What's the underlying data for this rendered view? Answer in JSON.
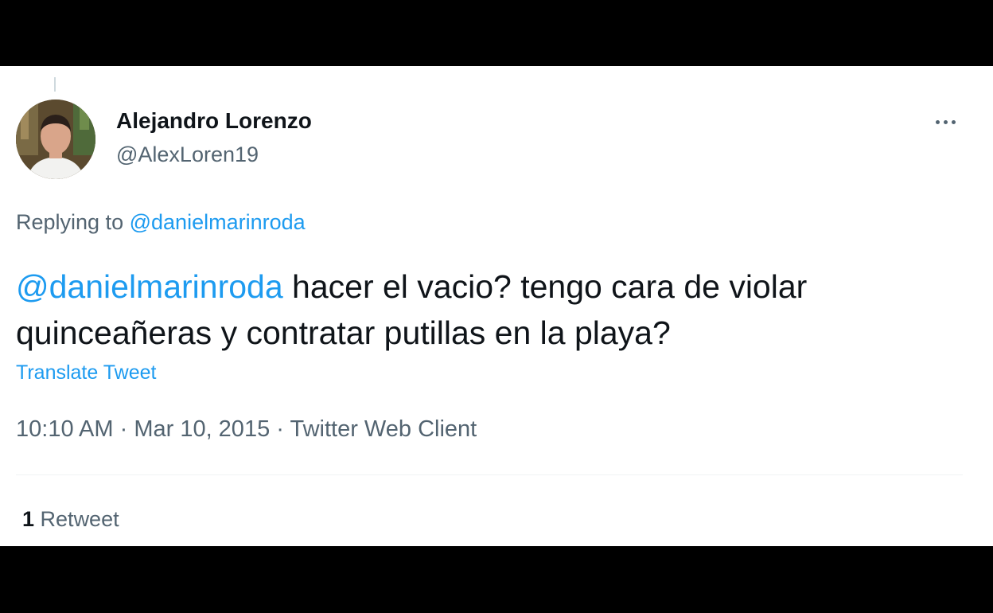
{
  "tweet": {
    "author": {
      "name": "Alejandro Lorenzo",
      "handle": "@AlexLoren19"
    },
    "replying_label": "Replying to",
    "replying_to": "@danielmarinroda",
    "text_mention": "@danielmarinroda",
    "text_body": " hacer el vacio? tengo cara de violar quinceañeras y contratar putillas en la playa?",
    "translate_label": "Translate Tweet",
    "time": "10:10 AM",
    "separator": " · ",
    "date": "Mar 10, 2015",
    "client": "Twitter Web Client",
    "retweet_count": "1",
    "retweet_label": "Retweet"
  },
  "colors": {
    "accent": "#1d9bf0",
    "text_primary": "#0f1419",
    "text_secondary": "#536471"
  },
  "icons": {
    "more": "more-horizontal-icon"
  }
}
